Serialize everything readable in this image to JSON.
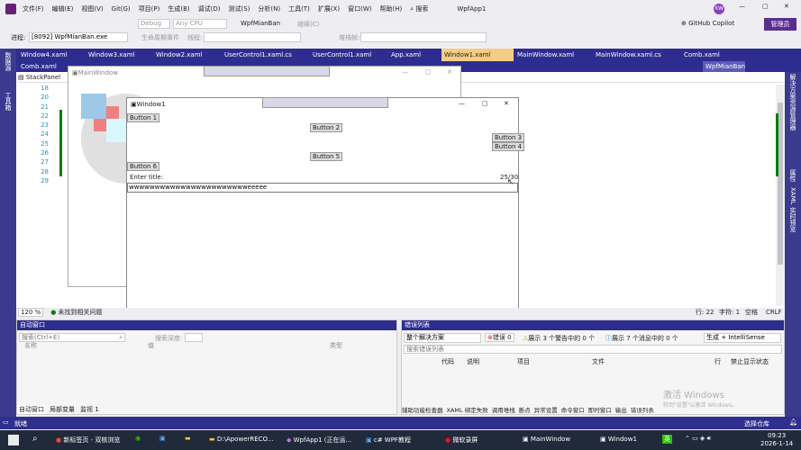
{
  "title_bar": {
    "menu": [
      "文件(F)",
      "编辑(E)",
      "视图(V)",
      "Git(G)",
      "项目(P)",
      "生成(B)",
      "调试(D)",
      "测试(S)",
      "分析(N)",
      "工具(T)",
      "扩展(X)",
      "窗口(W)",
      "帮助(H)"
    ],
    "search": "搜索",
    "app_name": "WpfApp1",
    "avatar": "XW",
    "manage": "管理员"
  },
  "toolbar": {
    "debug": "Debug",
    "cpu": "Any CPU",
    "project": "WpfMianBan",
    "run_label": "继续(C)",
    "copilot": "GitHub Copilot"
  },
  "toolbar2": {
    "process_label": "进程:",
    "process": "[8092] WpfMianBan.exe",
    "lifecycle": "生命周期事件",
    "thread": "线程:",
    "stackframe": "堆栈帧:"
  },
  "tabs": [
    "Window4.xaml",
    "Window3.xaml",
    "Window2.xaml",
    "UserControl1.xaml.cs",
    "UserControl1.xaml",
    "App.xaml",
    "Window1.xaml",
    "MainWindow.xaml",
    "MainWindow.xaml.cs",
    "Comb.xaml"
  ],
  "tabs_row2": {
    "left": "Comb.xaml",
    "right": "WpfMianBan"
  },
  "editor": {
    "breadcrumb": "StackPanel",
    "lines": [
      "18",
      "20",
      "21",
      "22",
      "23",
      "24",
      "25",
      "26",
      "27",
      "28",
      "29"
    ],
    "zoom": "120 %",
    "status": "未找到相关问题",
    "cursor": "行: 22",
    "char": "字符: 1",
    "mode": "空格",
    "eol": "CRLF"
  },
  "mainwindow": {
    "title": "MainWindow"
  },
  "window1": {
    "title": "Window1",
    "buttons": [
      "Button 1",
      "Button 2",
      "Button 3",
      "Button 4",
      "Button 5",
      "Button 6"
    ],
    "label": "Enter title:",
    "counter": "25/30",
    "input": "wwwwwwwwwwwwwwwwwwwwwwweeeee"
  },
  "autos": {
    "title": "自动窗口",
    "search": "搜索(Ctrl+E)",
    "depth": "搜索深度:",
    "cols": [
      "名称",
      "值",
      "类型"
    ],
    "tabs": [
      "自动窗口",
      "局部变量",
      "监视 1"
    ]
  },
  "errors": {
    "title": "错误列表",
    "scope": "整个解决方案",
    "errors": "错误 0",
    "warnings": "展示 3 个警告中的 0 个",
    "messages": "展示 7 个消息中的 0 个",
    "build": "生成 + IntelliSense",
    "search": "搜索错误列表",
    "cols": [
      "代码",
      "说明",
      "项目",
      "文件",
      "行",
      "禁止显示状态"
    ],
    "bottom_tabs": [
      "辅助功能检查器",
      "XAML 绑定失败",
      "调用堆栈",
      "断点",
      "异常设置",
      "命令窗口",
      "即时窗口",
      "输出",
      "错误列表"
    ]
  },
  "status": {
    "ready": "就绪",
    "right": "选择仓库"
  },
  "watermark": {
    "line1": "激活 Windows",
    "line2": "转到\"设置\"以激活 Windows。"
  },
  "taskbar": {
    "items": [
      "新标签页 - 双核浏览",
      "D:\\ApowerRECO...",
      "WpfApp1 (正在运...",
      "c# WPF教程",
      "微软录屏",
      "MainWindow",
      "Window1"
    ],
    "time": "09:23",
    "date": "2026-1-14",
    "lang": "英"
  }
}
